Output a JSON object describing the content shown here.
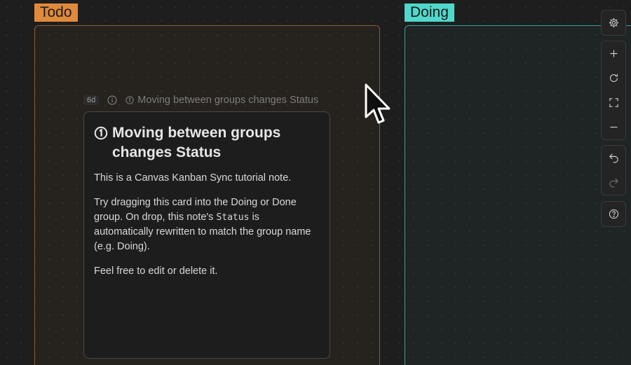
{
  "groups": {
    "todo": {
      "label": "Todo",
      "color": "#e08a3c"
    },
    "doing": {
      "label": "Doing",
      "color": "#4fd8cb"
    }
  },
  "card": {
    "age_badge": "6d",
    "header_title": "Moving between groups changes Status",
    "heading": "Moving between groups changes Status",
    "p1": "This is a Canvas Kanban Sync tutorial note.",
    "p2_before": "Try dragging this card into the Doing or Done group. On drop, this note's ",
    "p2_code": "Status",
    "p2_after": " is automatically rewritten to match the group name (e.g. Doing).",
    "p3": "Feel free to edit or delete it."
  },
  "toolbar": {
    "icons": [
      "gear-icon",
      "plus-icon",
      "refresh-icon",
      "fullscreen-icon",
      "minus-icon",
      "undo-icon",
      "redo-icon",
      "help-icon"
    ]
  }
}
